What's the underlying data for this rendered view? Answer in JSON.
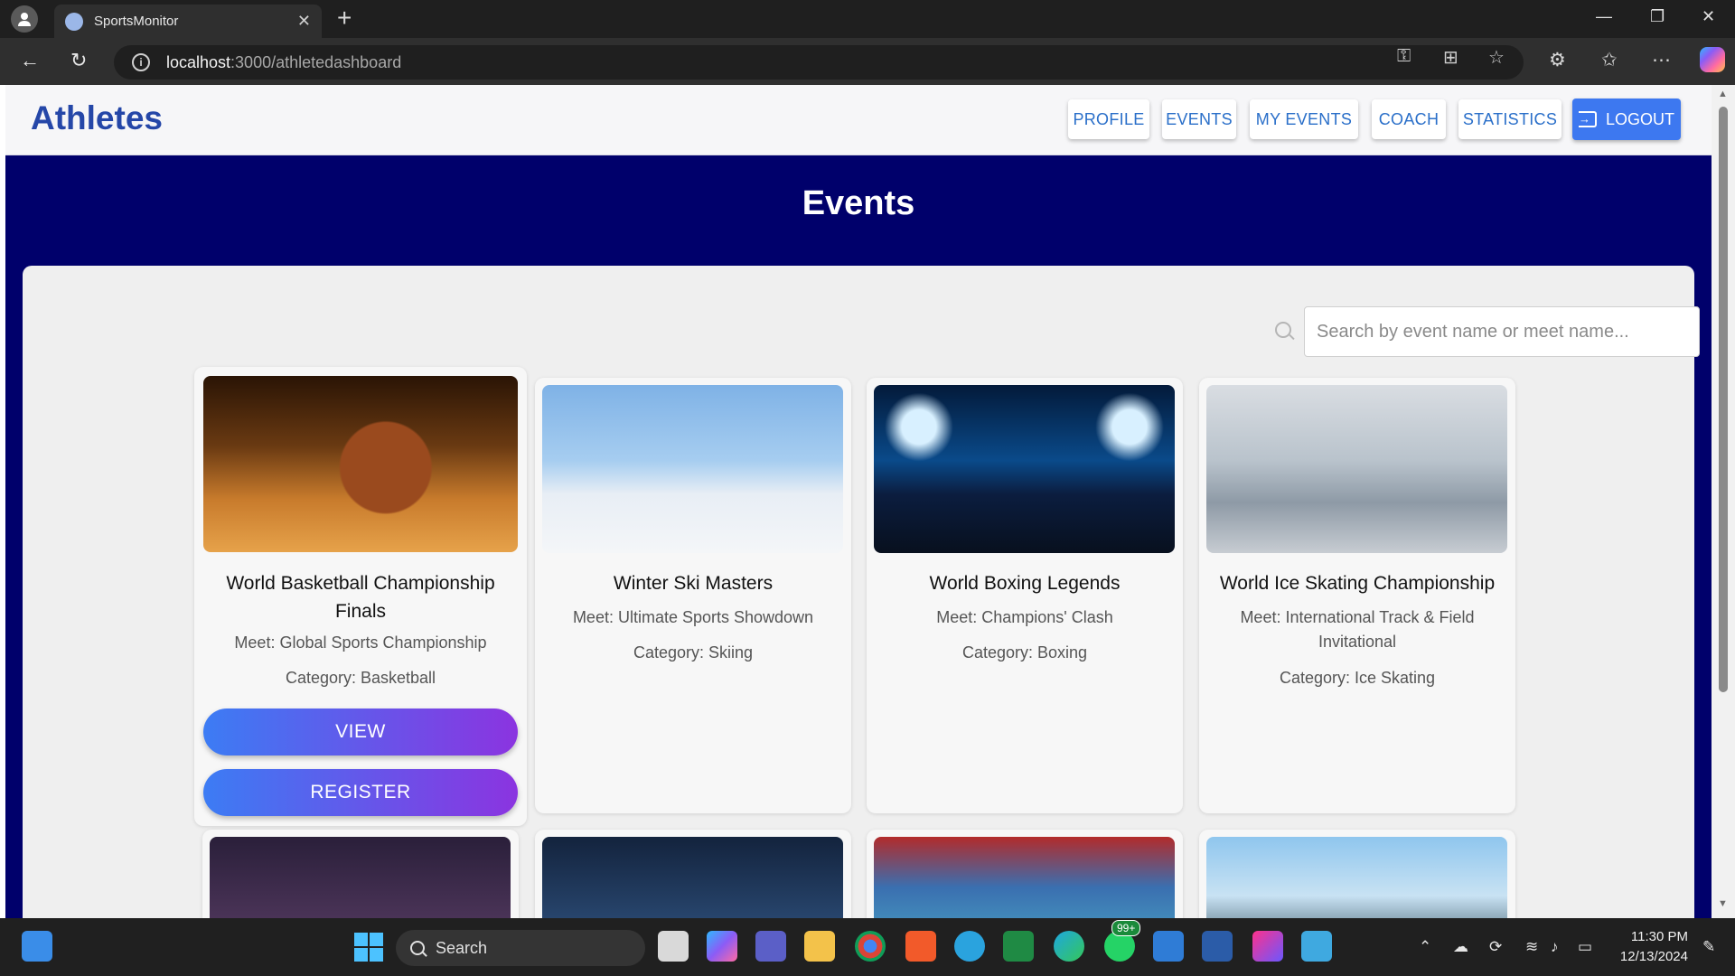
{
  "browser": {
    "tab_title": "SportsMonitor",
    "url_host": "localhost",
    "url_path": ":3000/athletedashboard"
  },
  "header": {
    "brand": "Athletes",
    "nav": [
      "PROFILE",
      "EVENTS",
      "MY EVENTS",
      "COACH",
      "STATISTICS"
    ],
    "logout_label": "LOGOUT"
  },
  "page_title": "Events",
  "search": {
    "placeholder": "Search by event name or meet name..."
  },
  "events": [
    {
      "title": "World Basketball Championship Finals",
      "meet": "Meet: Global Sports Championship",
      "category": "Category: Basketball",
      "image": "basketball-photo"
    },
    {
      "title": "Winter Ski Masters",
      "meet": "Meet: Ultimate Sports Showdown",
      "category": "Category: Skiing",
      "image": "ski-jump-photo"
    },
    {
      "title": "World Boxing Legends",
      "meet": "Meet: Champions' Clash",
      "category": "Category: Boxing",
      "image": "boxing-ring-photo"
    },
    {
      "title": "World Ice Skating Championship",
      "meet": "Meet: International Track & Field Invitational",
      "category": "Category: Ice Skating",
      "image": "ice-skates-photo"
    }
  ],
  "card_buttons": {
    "view": "VIEW",
    "register": "REGISTER"
  },
  "taskbar": {
    "search_label": "Search",
    "time": "11:30 PM",
    "date": "12/13/2024",
    "whatsapp_badge": "99+"
  },
  "colors": {
    "brand": "#2547a8",
    "page_bg": "#00006b",
    "nav_text": "#2a6fc9",
    "logout_bg": "#3d78f0",
    "button_gradient_start": "#3c7cf4",
    "button_gradient_end": "#8b34e0"
  }
}
